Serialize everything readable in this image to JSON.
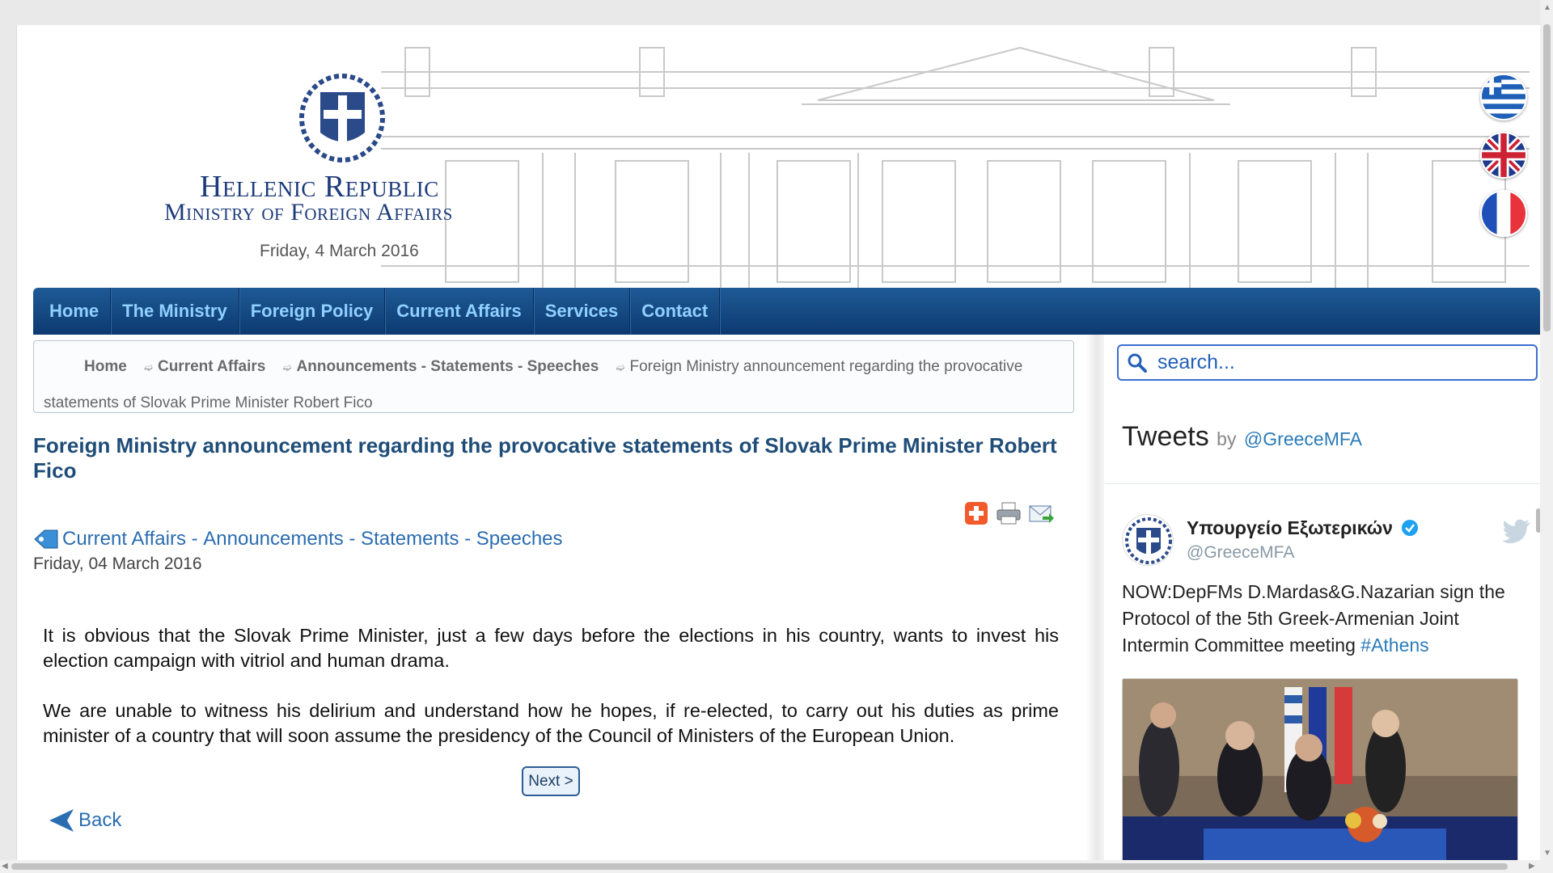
{
  "header": {
    "title_line1": "Hellenic Republic",
    "title_line2": "Ministry of Foreign Affairs",
    "date": "Friday, 4 March 2016"
  },
  "languages": [
    {
      "name": "greek-flag-icon"
    },
    {
      "name": "uk-flag-icon"
    },
    {
      "name": "french-flag-icon"
    }
  ],
  "nav": {
    "items": [
      {
        "label": "Home"
      },
      {
        "label": "The Ministry"
      },
      {
        "label": "Foreign Policy"
      },
      {
        "label": "Current Affairs"
      },
      {
        "label": "Services"
      },
      {
        "label": "Contact"
      }
    ]
  },
  "breadcrumb": {
    "home": "Home",
    "level1": "Current Affairs",
    "level2": "Announcements - Statements - Speeches",
    "current": "Foreign Ministry announcement regarding the provocative statements of Slovak Prime Minister Robert Fico"
  },
  "article": {
    "title": "Foreign Ministry announcement regarding the provocative statements of Slovak Prime Minister Robert Fico",
    "category_part1": "Current Affairs",
    "category_sep": " - ",
    "category_part2": "Announcements - Statements - Speeches",
    "date": "Friday, 04 March 2016",
    "paragraphs": [
      "It is obvious that the Slovak Prime Minister, just a few days before the elections in his country, wants to invest his election campaign with vitriol and human drama.",
      "We are unable to witness his delirium and understand how he hopes, if re-elected, to carry out his duties as prime minister of a country that will soon assume the presidency of the Council of Ministers of the European Union."
    ],
    "next_label": "Next >",
    "back_label": "Back"
  },
  "search": {
    "placeholder": "search..."
  },
  "tweets": {
    "heading": "Tweets",
    "by": "by",
    "handle": "@GreeceMFA",
    "tweet": {
      "name": "Υπουργείο Εξωτερικών",
      "handle": "@GreeceMFA",
      "text": "NOW:DepFMs D.Mardas&G.Nazarian sign the Protocol of the 5th Greek-Armenian Joint Intermin Committee meeting ",
      "hashtag": "#Athens"
    }
  },
  "colors": {
    "nav_top": "#1e5a96",
    "nav_bottom": "#0d3a70",
    "nav_text": "#8fd0ff",
    "title": "#1f4d78",
    "link": "#2b6db1",
    "logo": "#1d3b7a"
  }
}
